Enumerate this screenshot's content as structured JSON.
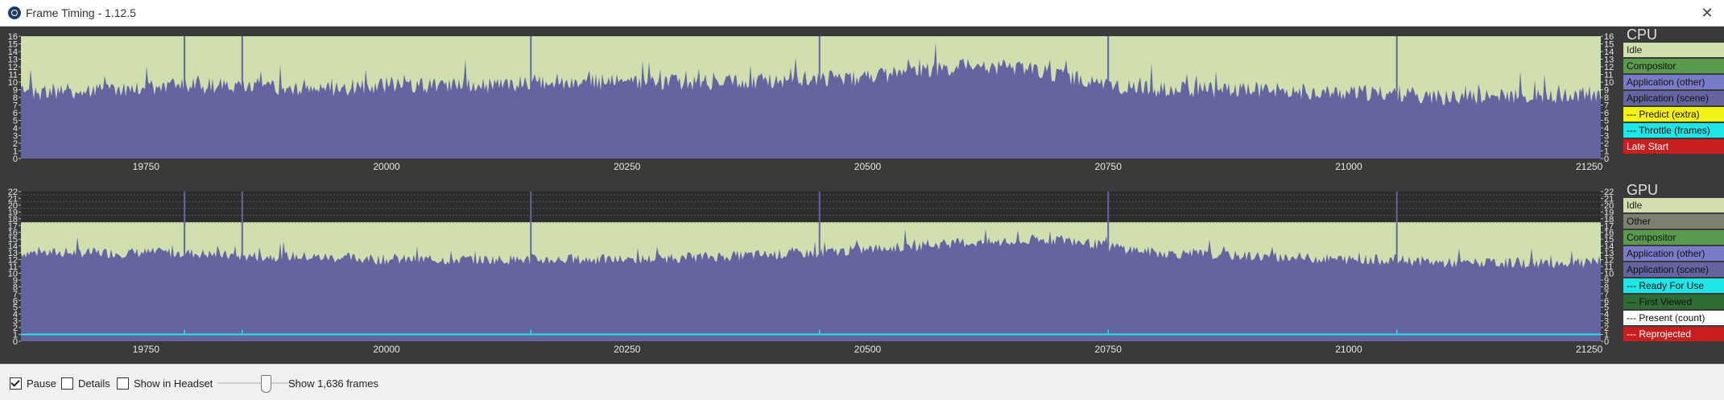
{
  "window": {
    "title": "Frame Timing - 1.12.5",
    "close_glyph": "✕",
    "icon": "steamvr-icon"
  },
  "cpu_panel": {
    "title": "CPU",
    "y_ticks": [
      "16",
      "15",
      "14",
      "13",
      "12",
      "11",
      "10",
      "9",
      "8",
      "7",
      "6",
      "5",
      "4",
      "3",
      "2",
      "1",
      "0"
    ],
    "legend": [
      {
        "label": "Idle",
        "bg": "#d1dfae",
        "fg": "#222"
      },
      {
        "label": "Compositor",
        "bg": "#5a9a4d",
        "fg": "#111"
      },
      {
        "label": "Application (other)",
        "bg": "#7a7bc6",
        "fg": "#111"
      },
      {
        "label": "Application (scene)",
        "bg": "#6364a0",
        "fg": "#111"
      },
      {
        "label": "--- Predict (extra)",
        "bg": "#f4f115",
        "fg": "#111"
      },
      {
        "label": "--- Throttle (frames)",
        "bg": "#1ee6e6",
        "fg": "#111"
      },
      {
        "label": "Late Start",
        "bg": "#c81e1e",
        "fg": "#ffffff"
      }
    ]
  },
  "gpu_panel": {
    "title": "GPU",
    "y_ticks": [
      "22",
      "21",
      "20",
      "19",
      "18",
      "17",
      "16",
      "15",
      "14",
      "13",
      "12",
      "11",
      "10",
      "9",
      "8",
      "7",
      "6",
      "5",
      "4",
      "3",
      "2",
      "1",
      "0"
    ],
    "legend": [
      {
        "label": "Idle",
        "bg": "#d1dfae",
        "fg": "#222"
      },
      {
        "label": "Other",
        "bg": "#7b8070",
        "fg": "#111"
      },
      {
        "label": "Compositor",
        "bg": "#5a9a4d",
        "fg": "#111"
      },
      {
        "label": "Application (other)",
        "bg": "#7a7bc6",
        "fg": "#111"
      },
      {
        "label": "Application (scene)",
        "bg": "#6364a0",
        "fg": "#111"
      },
      {
        "label": "--- Ready For Use",
        "bg": "#1ee6e6",
        "fg": "#111"
      },
      {
        "label": "--- First Viewed",
        "bg": "#2e6b35",
        "fg": "#111"
      },
      {
        "label": "--- Present (count)",
        "bg": "#ffffff",
        "fg": "#111"
      },
      {
        "label": "--- Reprojected",
        "bg": "#c81e1e",
        "fg": "#ffffff"
      }
    ]
  },
  "x_axis_labels": [
    "19750",
    "20000",
    "20250",
    "20500",
    "20750",
    "21000",
    "21250"
  ],
  "colors": {
    "idle": "#d1dfae",
    "app_scene": "#6364a0",
    "ready_line": "#1ee6e6",
    "grid": "#5a5a5a"
  },
  "chart_data": [
    {
      "type": "area",
      "title": "CPU",
      "x_range": [
        19620,
        21262
      ],
      "ylim": [
        0,
        16
      ],
      "series": [
        {
          "name": "Application (scene)",
          "x": [
            19620,
            19700,
            19790,
            19850,
            19900,
            20000,
            20100,
            20150,
            20250,
            20350,
            20450,
            20500,
            20550,
            20600,
            20650,
            20700,
            20750,
            20800,
            20900,
            21000,
            21050,
            21100,
            21150,
            21262
          ],
          "values": [
            8.5,
            9,
            9.5,
            9.5,
            9,
            9.5,
            9.5,
            10,
            10,
            10,
            10.5,
            10.5,
            11.5,
            12,
            12,
            11,
            9.5,
            9,
            9,
            8.5,
            8.5,
            8,
            8,
            8.5
          ]
        }
      ],
      "spikes_x": [
        19790,
        19850,
        20150,
        20450,
        20750,
        21050
      ],
      "spike_y": 16
    },
    {
      "type": "area",
      "title": "GPU",
      "x_range": [
        19620,
        21262
      ],
      "ylim": [
        0,
        22
      ],
      "series": [
        {
          "name": "Application (scene)",
          "x": [
            19620,
            19700,
            19790,
            19850,
            19900,
            20000,
            20100,
            20150,
            20250,
            20350,
            20450,
            20500,
            20550,
            20600,
            20650,
            20700,
            20750,
            20800,
            20900,
            21000,
            21050,
            21100,
            21150,
            21262
          ],
          "values": [
            13,
            13,
            13,
            12.5,
            12.5,
            12,
            12,
            12,
            12,
            12.5,
            13,
            13.5,
            14,
            14.5,
            14.5,
            15,
            14,
            13,
            12.5,
            12,
            12,
            11.5,
            11.5,
            11.5
          ]
        },
        {
          "name": "Ready For Use",
          "value": 1
        }
      ],
      "spikes_x": [
        19790,
        19850,
        20150,
        20450,
        20750,
        21050
      ],
      "spike_y": 22
    }
  ],
  "statusbar": {
    "pause_label": "Pause",
    "pause_checked": true,
    "details_label": "Details",
    "details_checked": false,
    "headset_label": "Show in Headset",
    "headset_checked": false,
    "slider_label": "Show 1,636 frames"
  }
}
